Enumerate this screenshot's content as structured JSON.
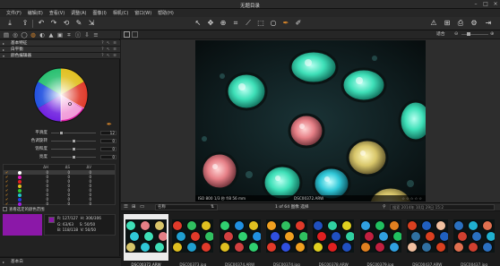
{
  "app": {
    "title": "无题目录"
  },
  "menu": [
    "文件(F)",
    "编辑(E)",
    "查看(V)",
    "调整(A)",
    "图像(I)",
    "相机(C)",
    "窗口(W)",
    "帮助(H)"
  ],
  "left_panel": {
    "sections": {
      "basic": "基本特征",
      "white_balance": "白平衡",
      "color_editor": "颜色编辑器"
    },
    "sliders": [
      {
        "label": "平滑度",
        "value": "12",
        "pos": 0.22
      },
      {
        "label": "色调旋转",
        "value": "0",
        "pos": 0.5
      },
      {
        "label": "饱和度",
        "value": "0",
        "pos": 0.5
      },
      {
        "label": "亮度",
        "value": "0",
        "pos": 0.5
      }
    ],
    "table_headers": [
      "ΔH",
      "ΔS",
      "ΔV"
    ],
    "color_rows": [
      {
        "color": "#ffffff",
        "v": [
          "0",
          "0",
          "0"
        ]
      },
      {
        "color": "#e81cc8",
        "v": [
          "0",
          "0",
          "0"
        ]
      },
      {
        "color": "#e02020",
        "v": [
          "0",
          "0",
          "0"
        ]
      },
      {
        "color": "#e0c020",
        "v": [
          "0",
          "0",
          "0"
        ]
      },
      {
        "color": "#30c830",
        "v": [
          "0",
          "0",
          "0"
        ]
      },
      {
        "color": "#20c8c8",
        "v": [
          "0",
          "0",
          "0"
        ]
      },
      {
        "color": "#2040e0",
        "v": [
          "0",
          "0",
          "0"
        ]
      },
      {
        "color": "#a020e0",
        "v": [
          "0",
          "0",
          "0"
        ]
      }
    ],
    "selected_range_label": "查看选定的颜色范围",
    "info": {
      "r1": [
        "R:",
        "127/127",
        "H:",
        "306/306"
      ],
      "r2": [
        "G:",
        "63/63",
        "S:",
        "50/50"
      ],
      "r3": [
        "B:",
        "118/118",
        "V:",
        "50/50"
      ]
    },
    "bottom_section": "基本白"
  },
  "viewer": {
    "zoom_label": "适合",
    "photo_info": "ISO 800  1/3 秒  f/8  56 mm",
    "photo_filename": "DSC00372.ARW"
  },
  "browser": {
    "sort_label": "名称",
    "count_label": "1 of 64 图像  选择",
    "search_placeholder": "搜索 2014年  10月 29日 15:2",
    "thumbs": [
      {
        "name": "DSC00372.ARW",
        "selected": true
      },
      {
        "name": "DSC00373.jpg",
        "selected": false
      },
      {
        "name": "DSC00374.ARW",
        "selected": false
      },
      {
        "name": "DSC00374.jpg",
        "selected": false
      },
      {
        "name": "DSC00378.ARW",
        "selected": false
      },
      {
        "name": "DSC00379.jpg",
        "selected": false
      },
      {
        "name": "DSC00437.ARW",
        "selected": false
      },
      {
        "name": "DSC00437.jpg",
        "selected": false
      }
    ]
  }
}
